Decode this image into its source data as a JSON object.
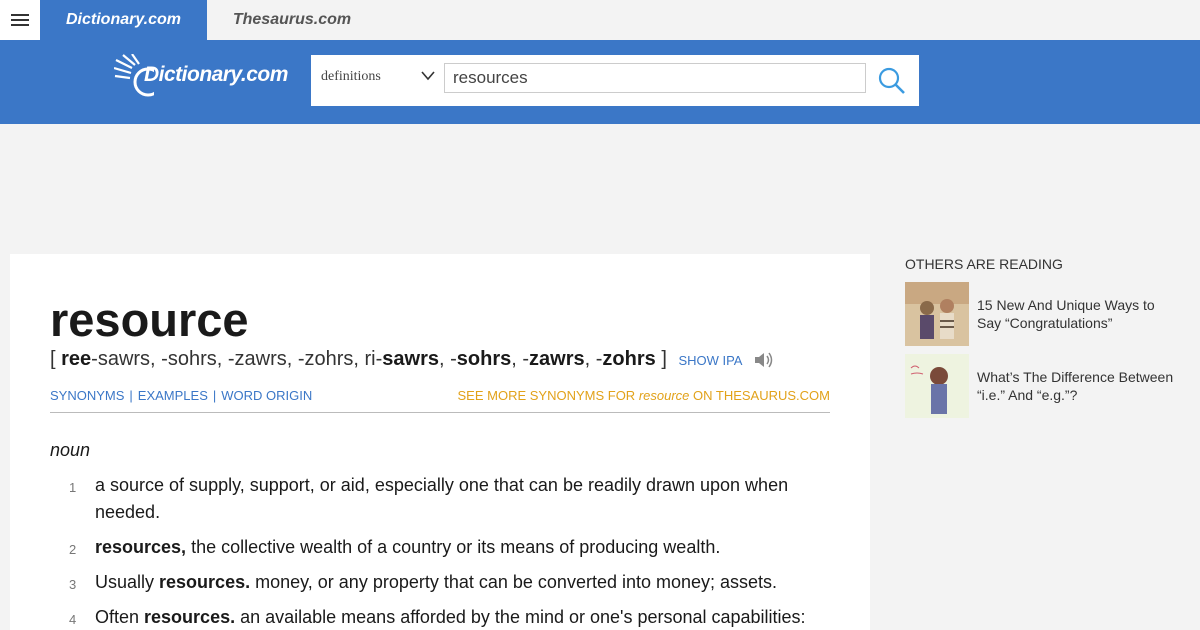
{
  "topbar": {
    "dictionary_tab": "Dictionary.com",
    "thesaurus_tab": "Thesaurus.com"
  },
  "header": {
    "logo_text": "Dictionary.com",
    "search": {
      "mode": "definitions",
      "query": "resources"
    }
  },
  "entry": {
    "word": "resource",
    "pronunciation": {
      "open": "[",
      "parts": [
        {
          "bold": "ree",
          "rest": "-sawrs, -sohrs, -zawrs, -zohrs, ri-"
        },
        {
          "bold": "sawrs",
          "rest": ", -"
        },
        {
          "bold": "sohrs",
          "rest": ", -"
        },
        {
          "bold": "zawrs",
          "rest": ", -"
        },
        {
          "bold": "zohrs",
          "rest": " "
        }
      ],
      "close": "]",
      "show_ipa": "SHOW IPA"
    },
    "links": [
      "SYNONYMS",
      "EXAMPLES",
      "WORD ORIGIN"
    ],
    "see_more": {
      "prefix": "SEE MORE SYNONYMS FOR ",
      "word": "resource",
      "suffix": " ON THESAURUS.COM"
    },
    "part_of_speech": "noun",
    "definitions": [
      {
        "num": "1",
        "lead": "",
        "text": "a source of supply, support, or aid, especially one that can be readily drawn upon when needed."
      },
      {
        "num": "2",
        "lead": "resources,",
        "text": " the collective wealth of a country or its means of producing wealth."
      },
      {
        "num": "3",
        "prefix": "Usually ",
        "lead": "resources.",
        "text": " money, or any property that can be converted into money; assets."
      },
      {
        "num": "4",
        "prefix": "Often ",
        "lead": "resources.",
        "text": " an available means afforded by the mind or one's personal capabilities:"
      }
    ]
  },
  "sidebar": {
    "title": "OTHERS ARE READING",
    "items": [
      {
        "title": "15 New And Unique Ways to Say “Congratulations”"
      },
      {
        "title": "What’s The Difference Between “i.e.” And “e.g.”?"
      }
    ]
  },
  "colors": {
    "brand_blue": "#3b77c7",
    "accent_gold": "#e2a21a"
  }
}
